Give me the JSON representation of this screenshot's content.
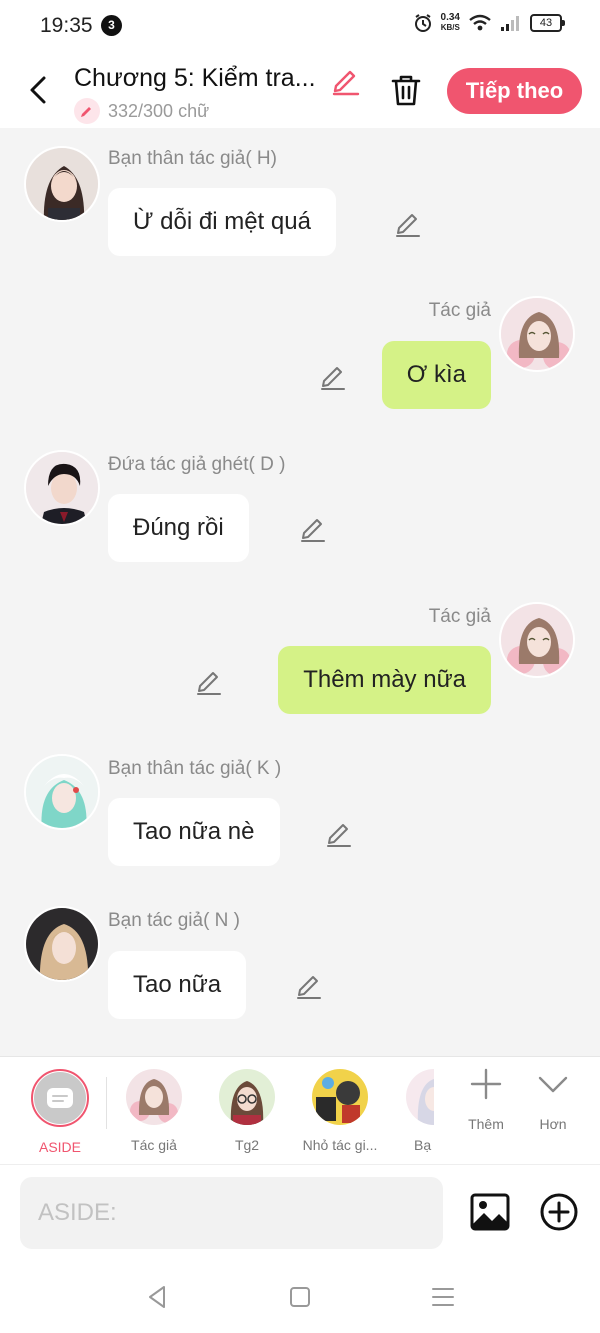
{
  "status_bar": {
    "time": "19:35",
    "notification_count": "3",
    "net_speed": "0.34",
    "net_speed_unit": "KB/S",
    "battery": "43"
  },
  "header": {
    "title": "Chương 5: Kiểm tra...",
    "word_count": "332/300 chữ",
    "next_label": "Tiếp theo"
  },
  "messages": [
    {
      "side": "left",
      "sender": "Bạn thân tác giả( H)",
      "text": "Ừ dỗi đi mệt quá"
    },
    {
      "side": "right",
      "sender": "Tác giả",
      "text": "Ơ kìa"
    },
    {
      "side": "left",
      "sender": "Đứa tác giả ghét( D )",
      "text": "Đúng rồi"
    },
    {
      "side": "right",
      "sender": "Tác giả",
      "text": "Thêm mày nữa"
    },
    {
      "side": "left",
      "sender": "Bạn thân tác giả(  K )",
      "text": "Tao nữa nè"
    },
    {
      "side": "left",
      "sender": "Bạn tác giả( N )",
      "text": "Tao nữa"
    }
  ],
  "characters": [
    {
      "label": "ASIDE"
    },
    {
      "label": "Tác giả"
    },
    {
      "label": "Tg2"
    },
    {
      "label": "Nhỏ tác gi..."
    },
    {
      "label": "Bạ"
    }
  ],
  "more_actions": {
    "add_label": "Thêm",
    "more_label": "Hơn"
  },
  "input": {
    "placeholder": "ASIDE:"
  },
  "colors": {
    "accent": "#f0556f",
    "right_bubble": "#d5f287",
    "left_bubble": "#ffffff",
    "background": "#f4f4f4"
  }
}
